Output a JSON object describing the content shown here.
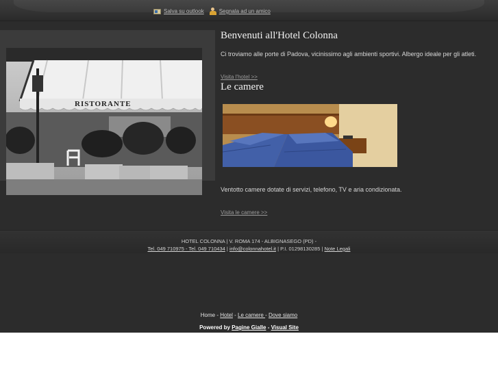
{
  "header": {
    "links": [
      {
        "icon": "outlook-icon",
        "label": " Salva su outlook"
      },
      {
        "icon": "friend-icon",
        "label": " Segnala ad un amico"
      }
    ]
  },
  "main": {
    "welcome_title": "Benvenuti all'Hotel Colonna",
    "welcome_text": "Ci troviamo alle porte di Padova, vicinissimo agli ambienti sportivi. Albergo ideale per gli atleti.",
    "visit_hotel": "Visita l'hotel >>",
    "rooms_title": "Le camere",
    "rooms_text": "Ventotto camere dotate di servizi, telefono, TV e aria condizionata.",
    "visit_rooms": "Visita le camere >>",
    "photo_sign": "RISTORANTE"
  },
  "footer": {
    "address": "HOTEL COLONNA | V. ROMA 174 - ALBIGNASEGO (PD) -",
    "phones": "Tel. 049 710975 - Tel. 049 710434",
    "sep1": " | ",
    "email": "info@colonnahotel.it",
    "piva": " | P.I. 01298130285 | ",
    "legal": "Note Legali"
  },
  "bottom_nav": {
    "home": "Home",
    "sep": "  -  ",
    "hotel": "Hotel",
    "camere": "Le camere ",
    "dove": "Dove siamo"
  },
  "powered": {
    "label": "Powered by ",
    "pagine": "Pagine Gialle",
    "dash": " - ",
    "visual": "Visual Site"
  },
  "colors": {
    "background": "#2c2c2c",
    "text": "#dddddd",
    "link_muted": "#9c9c9c"
  }
}
